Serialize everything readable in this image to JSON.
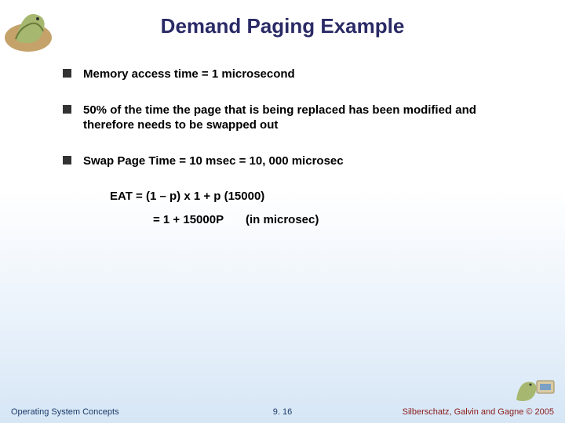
{
  "title": "Demand Paging Example",
  "bullets": [
    "Memory access time = 1 microsecond",
    "50% of the time the page that is being replaced has been modified and therefore needs to be swapped out",
    "Swap Page Time = 10 msec = 10, 000 microsec"
  ],
  "formulas": {
    "line1": "EAT = (1 – p) x 1 + p (15000)",
    "line2": "= 1 + 15000P",
    "annot": "(in microsec)"
  },
  "footer": {
    "left": "Operating System Concepts",
    "center": "9. 16",
    "right": "Silberschatz, Galvin and Gagne © 2005"
  },
  "icons": {
    "dino_tl": "dinosaur-illustration",
    "dino_br": "dinosaur-small-illustration"
  }
}
